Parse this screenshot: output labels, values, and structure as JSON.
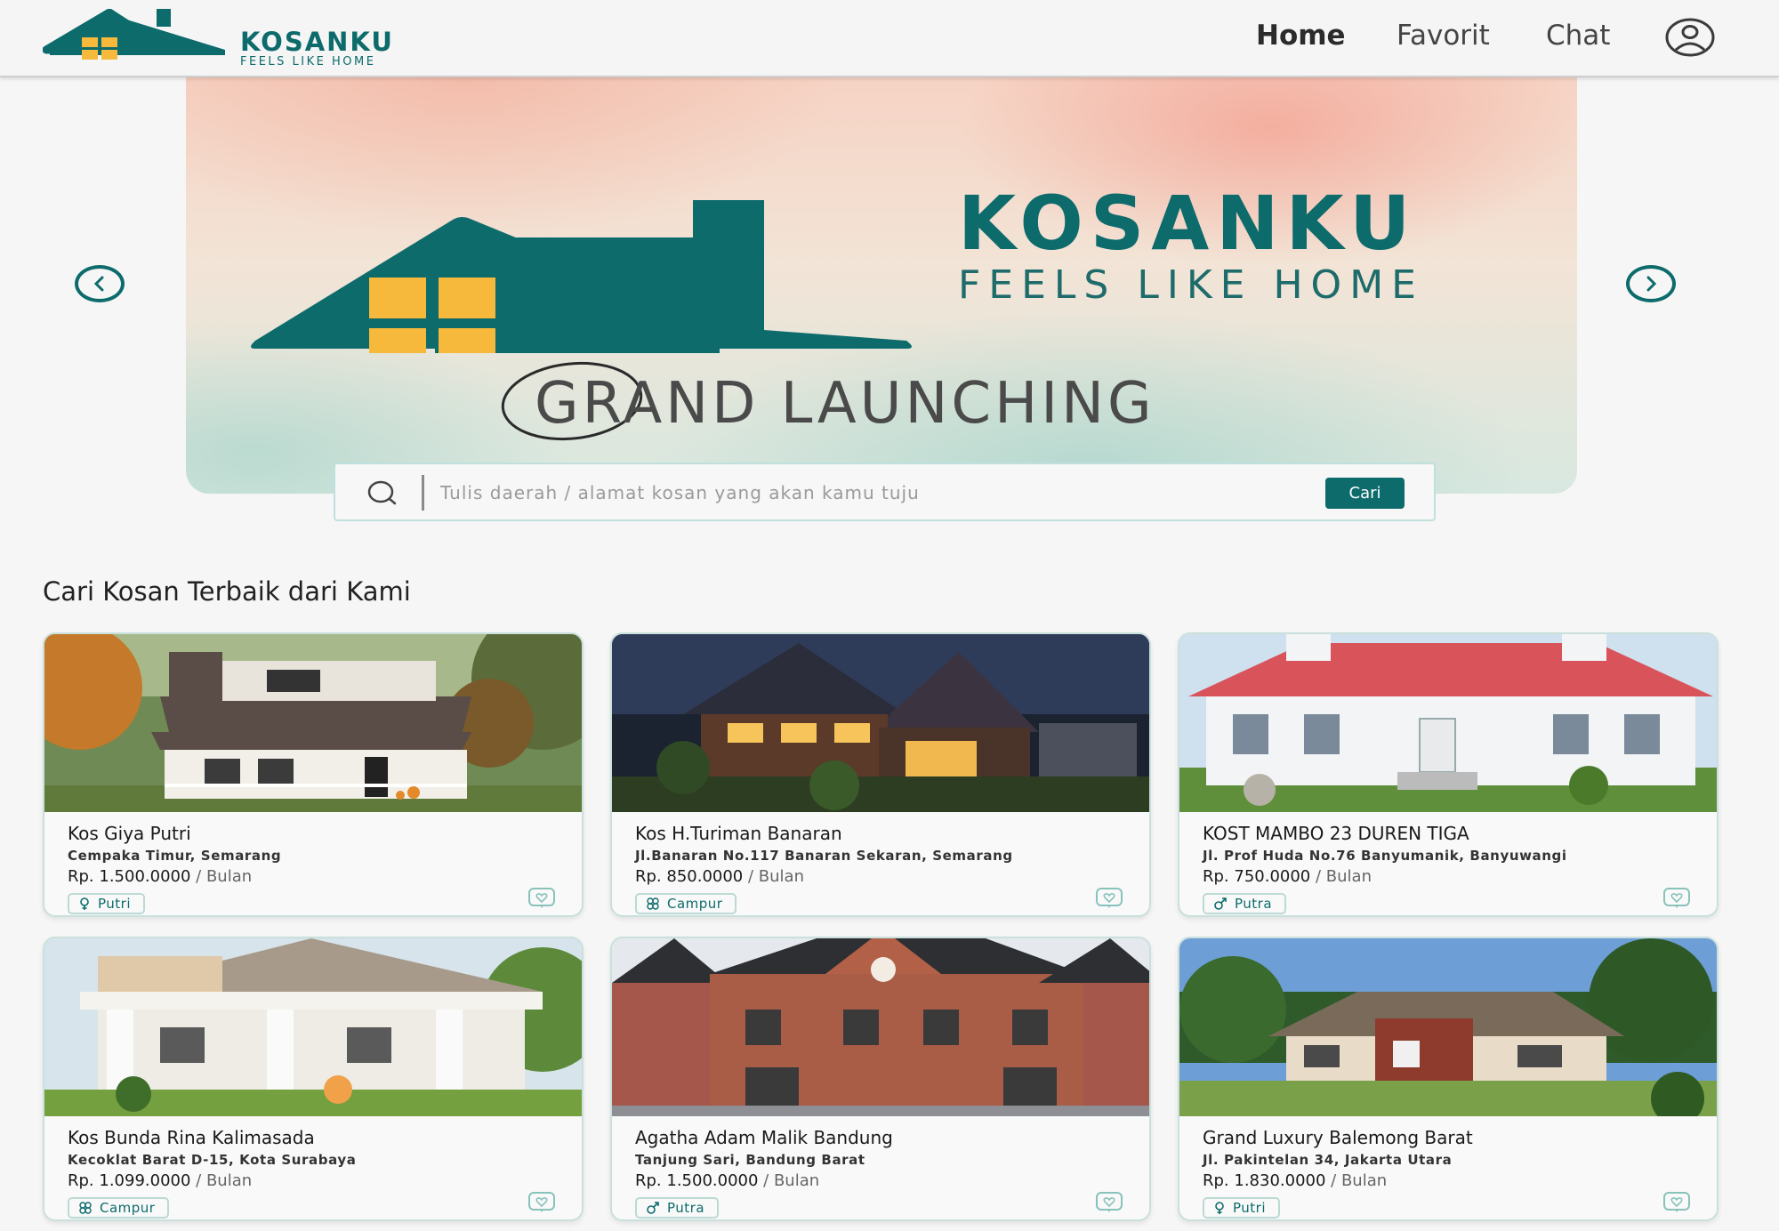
{
  "brand": {
    "name": "KOSANKU",
    "tagline": "FEELS LIKE HOME"
  },
  "nav": {
    "home": "Home",
    "favorit": "Favorit",
    "chat": "Chat"
  },
  "hero": {
    "title": "KOSANKU",
    "subtitle": "FEELS LIKE HOME",
    "banner_text": "GRAND LAUNCHING"
  },
  "search": {
    "placeholder": "Tulis daerah / alamat kosan yang akan kamu tuju",
    "button_label": "Cari"
  },
  "section_title": "Cari Kosan Terbaik dari Kami",
  "price_suffix": "/ Bulan",
  "listings": [
    {
      "name": "Kos Giya Putri",
      "address": "Cempaka Timur, Semarang",
      "price": "Rp. 1.500.0000",
      "type": "Putri",
      "type_icon": "female-icon"
    },
    {
      "name": "Kos H.Turiman Banaran",
      "address": "Jl.Banaran No.117 Banaran Sekaran, Semarang",
      "price": "Rp. 850.0000",
      "type": "Campur",
      "type_icon": "mixed-gender-icon"
    },
    {
      "name": "KOST MAMBO 23 DUREN TIGA",
      "address": "Jl. Prof Huda No.76 Banyumanik, Banyuwangi",
      "price": "Rp. 750.0000",
      "type": "Putra",
      "type_icon": "male-icon"
    },
    {
      "name": "Kos Bunda Rina Kalimasada",
      "address": "Kecoklat Barat D-15, Kota Surabaya",
      "price": "Rp. 1.099.0000",
      "type": "Campur",
      "type_icon": "mixed-gender-icon"
    },
    {
      "name": "Agatha Adam Malik Bandung",
      "address": "Tanjung Sari, Bandung Barat",
      "price": "Rp. 1.500.0000",
      "type": "Putra",
      "type_icon": "male-icon"
    },
    {
      "name": "Grand Luxury Balemong Barat",
      "address": "Jl. Pakintelan 34, Jakarta Utara",
      "price": "Rp. 1.830.0000",
      "type": "Putri",
      "type_icon": "female-icon"
    }
  ],
  "colors": {
    "primary": "#0d6b6c",
    "window_yellow": "#f6b93b",
    "nav_bg": "#f5f5f5"
  }
}
